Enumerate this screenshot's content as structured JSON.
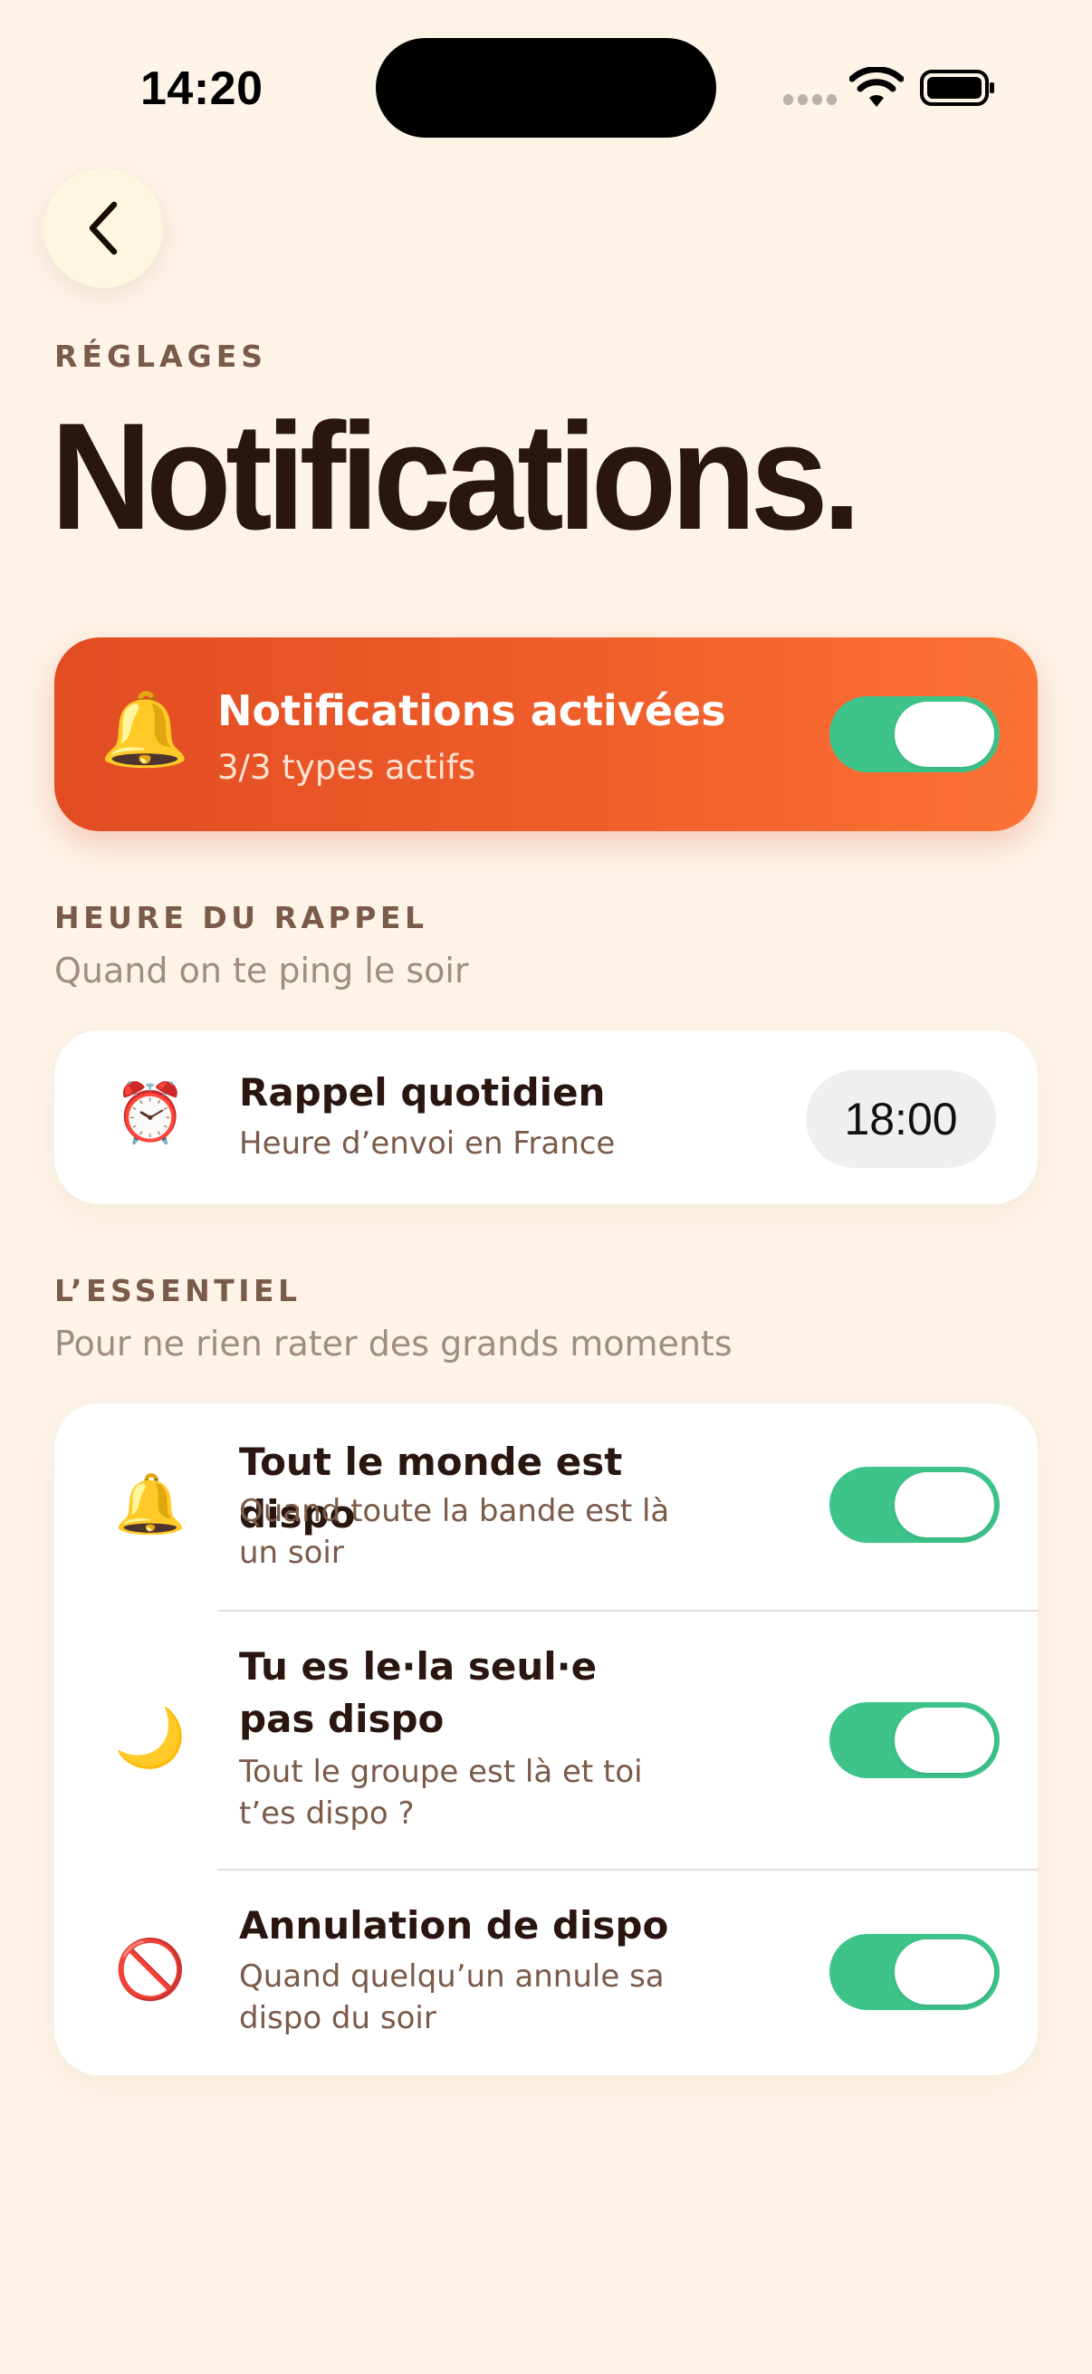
{
  "status_bar": {
    "time": "14:20"
  },
  "header": {
    "eyebrow": "RÉGLAGES",
    "title": "Notifications."
  },
  "master": {
    "icon": "bell-icon",
    "emoji": "🔔",
    "title": "Notifications activées",
    "subtitle": "3/3 types actifs",
    "enabled": true
  },
  "reminder_section": {
    "title": "HEURE DU RAPPEL",
    "subtitle": "Quand on te ping le soir",
    "item": {
      "icon": "alarm-clock-icon",
      "emoji": "⏰",
      "title": "Rappel quotidien",
      "description": "Heure d’envoi en France",
      "time": "18:00"
    }
  },
  "essential_section": {
    "title": "L’ESSENTIEL",
    "subtitle": "Pour ne rien rater des grands moments",
    "items": [
      {
        "icon": "bell-icon",
        "emoji": "🔔",
        "title": "Tout le monde est dispo",
        "description": "Quand toute la bande est là un soir",
        "enabled": true
      },
      {
        "icon": "crescent-moon-icon",
        "emoji": "🌙",
        "title": "Tu es le·la seul·e pas dispo",
        "description": "Tout le groupe est là et toi t’es dispo ?",
        "enabled": true
      },
      {
        "icon": "no-entry-icon",
        "emoji": "🚫",
        "title": "Annulation de dispo",
        "description": "Quand quelqu’un annule sa dispo du soir",
        "enabled": true
      }
    ]
  },
  "colors": {
    "background": "#fdf3e7",
    "accent_start": "#e14c22",
    "accent_end": "#fc7235",
    "toggle_on": "#3ec48a",
    "text_dark": "#2a1610",
    "text_muted": "#7a5a48"
  }
}
